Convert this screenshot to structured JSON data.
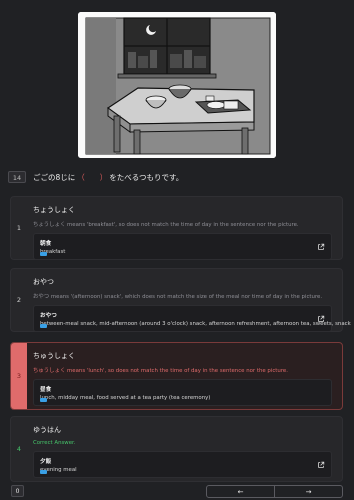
{
  "question": {
    "number": "14",
    "text_before": "ごごの8じに",
    "blank": "（　　）",
    "text_after": "をたべるつもりです。"
  },
  "options": [
    {
      "index": "1",
      "word": "ちょうしょく",
      "explanation": "ちょうしょく means 'breakfast', so does not match the time of day in the sentence nor the picture.",
      "kanji": "朝食",
      "meaning": "breakfast"
    },
    {
      "index": "2",
      "word": "おやつ",
      "explanation": "おやつ means '(afternoon) snack', which does not match the size of the meal nor time of day in the picture.",
      "kanji": "おやつ",
      "meaning": "between-meal snack, mid-afternoon (around 3 o'clock) snack, afternoon refreshment, afternoon tea, sweets, snack"
    },
    {
      "index": "3",
      "word": "ちゅうしょく",
      "explanation": "ちゅうしょく means 'lunch', so does not match the time of day in the sentence nor the picture.",
      "kanji": "昼食",
      "meaning": "lunch, midday meal, food served at a tea party (tea ceremony)"
    },
    {
      "index": "4",
      "word": "ゆうはん",
      "correct_label": "Correct Answer.",
      "kanji": "夕飯",
      "meaning": "evening meal"
    }
  ],
  "footer": {
    "counter": "0",
    "prev_icon": "←",
    "next_icon": "→"
  },
  "icons": {
    "external_link": "external-link-icon",
    "tag": "tag-icon"
  },
  "colors": {
    "background": "#202124",
    "wrong": "#e06b6b",
    "correct": "#46c46a",
    "tag": "#3aa0e6"
  }
}
